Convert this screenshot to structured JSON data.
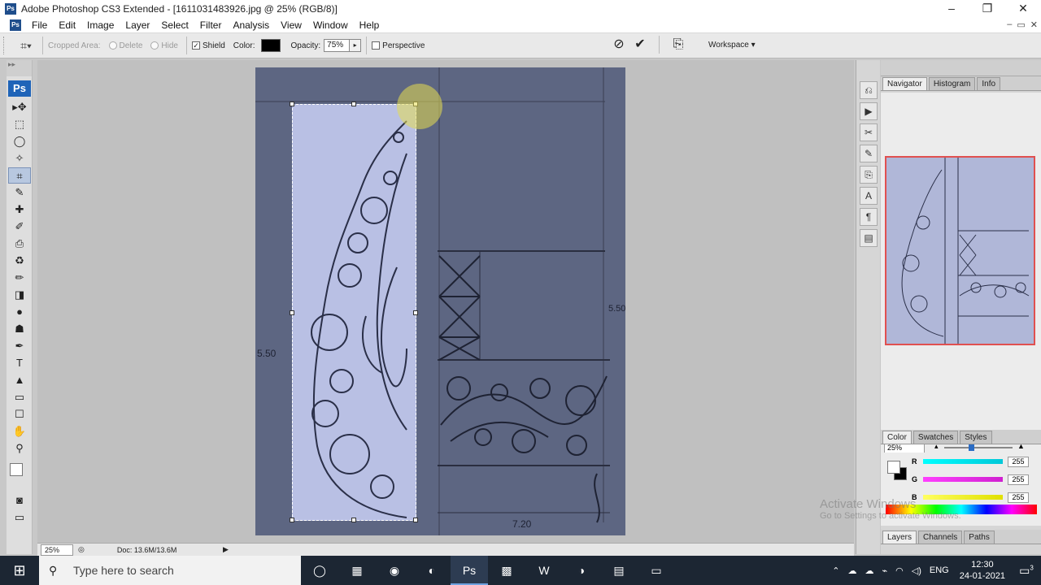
{
  "window": {
    "title": "Adobe Photoshop CS3 Extended - [1611031483926.jpg @ 25% (RGB/8)]",
    "controls": [
      "–",
      "❐",
      "✕"
    ]
  },
  "menubar": {
    "items": [
      "File",
      "Edit",
      "Image",
      "Layer",
      "Select",
      "Filter",
      "Analysis",
      "View",
      "Window",
      "Help"
    ],
    "doc_controls": [
      "–",
      "▭",
      "✕"
    ]
  },
  "options": {
    "cropped_area_label": "Cropped Area:",
    "delete_label": "Delete",
    "hide_label": "Hide",
    "shield_label": "Shield",
    "shield_checked": true,
    "color_label": "Color:",
    "opacity_label": "Opacity:",
    "opacity_value": "75%",
    "perspective_label": "Perspective",
    "perspective_checked": false,
    "workspace_label": "Workspace ▾"
  },
  "toolbox": {
    "badge": "Ps",
    "tools": [
      "▸✥",
      "⬚",
      "◯",
      "✧",
      "⌗",
      "✎",
      "✚",
      "✐",
      "⎙",
      "♻",
      "✏",
      "◨",
      "●",
      "☗",
      "✒",
      "T",
      "▲",
      "▭",
      "☐",
      "✋",
      "⚲"
    ]
  },
  "status": {
    "zoom": "25%",
    "doc": "Doc: 13.6M/13.6M"
  },
  "navigator": {
    "tabs": [
      "Navigator",
      "Histogram",
      "Info"
    ],
    "zoom": "25%"
  },
  "color_panel": {
    "tabs": [
      "Color",
      "Swatches",
      "Styles"
    ],
    "channels": [
      {
        "label": "R",
        "value": "255",
        "color": "#00d8e8"
      },
      {
        "label": "G",
        "value": "255",
        "color": "#e030e0"
      },
      {
        "label": "B",
        "value": "255",
        "color": "#f0f000"
      }
    ]
  },
  "layers_panel": {
    "tabs": [
      "Layers",
      "Channels",
      "Paths"
    ]
  },
  "watermark": {
    "line1": "Activate Windows",
    "line2": "Go to Settings to activate Windows."
  },
  "taskbar": {
    "search_placeholder": "Type here to search",
    "time": "12:30",
    "date": "24-01-2021",
    "language": "ENG",
    "notifications": "3"
  },
  "image_marks": {
    "left_label": "5.50",
    "right_label": "5.50",
    "bottom_label": "7.20"
  },
  "accent_colors": {
    "photoshop_blue": "#1f64b8",
    "taskbar": "#1c2633"
  }
}
